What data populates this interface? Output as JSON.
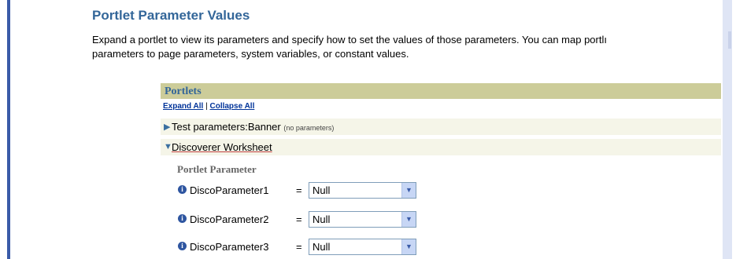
{
  "page": {
    "title": "Portlet Parameter Values",
    "description": "Expand a portlet to view its parameters and specify how to set the values of those parameters. You can map portlı",
    "description_line2": "parameters to page parameters, system variables, or constant values."
  },
  "portlets": {
    "header": "Portlets",
    "expand_all": "Expand All",
    "separator": "|",
    "collapse_all": "Collapse All",
    "items": [
      {
        "label": "Test parameters:Banner",
        "note": "(no parameters)",
        "icon": "triangle-right-icon"
      },
      {
        "label": "Discoverer Worksheet",
        "icon": "triangle-down-icon"
      }
    ]
  },
  "parameters": {
    "header": "Portlet Parameter",
    "equals": "=",
    "rows": [
      {
        "name": "DiscoParameter1",
        "value": "Null"
      },
      {
        "name": "DiscoParameter2",
        "value": "Null"
      },
      {
        "name": "DiscoParameter3",
        "value": "Null"
      }
    ]
  },
  "colors": {
    "title": "#336699",
    "header_bg": "#cccc99",
    "row_bg": "#f5f5e8",
    "accent": "#3a5ba8"
  }
}
